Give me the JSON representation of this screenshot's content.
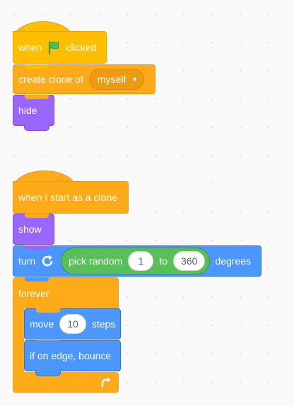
{
  "script1": {
    "hat": {
      "label_before": "when",
      "flag_icon": "green-flag-icon",
      "label_after": "clicked"
    },
    "create_clone": {
      "label": "create clone of",
      "target": "myself"
    },
    "hide": {
      "label": "hide"
    }
  },
  "script2": {
    "hat": {
      "label": "when I start as a clone"
    },
    "show": {
      "label": "show"
    },
    "turn": {
      "label": "turn",
      "icon": "rotate-right-icon",
      "random": {
        "label": "pick random",
        "from": "1",
        "to_label": "to",
        "to": "360"
      },
      "suffix": "degrees"
    },
    "forever": {
      "label": "forever",
      "loop_icon": "loop-arrow-icon"
    },
    "move": {
      "label": "move",
      "steps": "10",
      "suffix": "steps"
    },
    "bounce": {
      "label": "if on edge, bounce"
    }
  },
  "colors": {
    "events": "#ffbf00",
    "control": "#ffab19",
    "looks": "#9966ff",
    "motion": "#4c97ff",
    "operators": "#59c059",
    "workspace": "#f9f9f9"
  }
}
